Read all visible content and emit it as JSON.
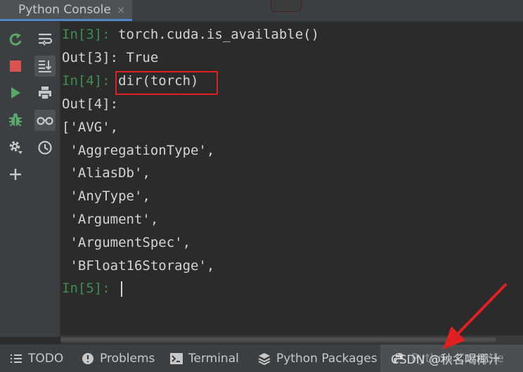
{
  "tab": {
    "title": "Python Console",
    "close": "×"
  },
  "console": {
    "lines": [
      {
        "prompt": "In[3]: ",
        "text": "torch.cuda.is_available()"
      },
      {
        "prompt": "",
        "text": "Out[3]: True"
      },
      {
        "prompt": "In[4]: ",
        "text": "dir(torch)"
      },
      {
        "prompt": "",
        "text": "Out[4]:"
      },
      {
        "prompt": "",
        "text": "['AVG',"
      },
      {
        "prompt": "",
        "text": " 'AggregationType',"
      },
      {
        "prompt": "",
        "text": " 'AliasDb',"
      },
      {
        "prompt": "",
        "text": " 'AnyType',"
      },
      {
        "prompt": "",
        "text": " 'Argument',"
      },
      {
        "prompt": "",
        "text": " 'ArgumentSpec',"
      },
      {
        "prompt": "",
        "text": " 'BFloat16Storage',"
      },
      {
        "prompt": "In[5]: ",
        "text": ""
      }
    ]
  },
  "statusbar": {
    "todo": "TODO",
    "problems": "Problems",
    "terminal": "Terminal",
    "python_packages": "Python Packages",
    "python_console": "Python Console"
  },
  "watermark": "CSDN @秋名喝椰汁",
  "colors": {
    "accent": "#4a88c7",
    "prompt": "#3e8e4e",
    "highlight": "#e02020",
    "rerun": "#59a869",
    "stop": "#d9534f"
  }
}
